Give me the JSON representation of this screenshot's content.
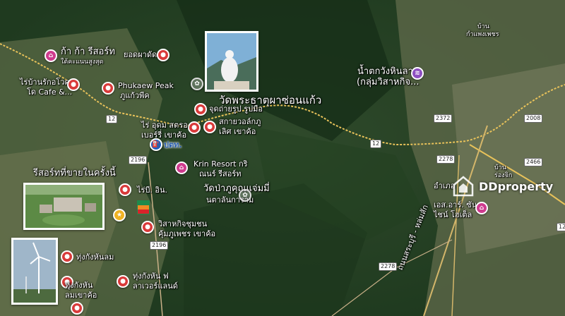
{
  "places": {
    "kakaresort": "ก้า ก้า รีสอร์ท",
    "kakaresort_sub": "ใต้คะแนนสูงสุด",
    "yodphadet": "ยอดผาดัด",
    "raibanrak_1": "ไร่บ้านรักอโวคา",
    "raibanrak_2": "โด Cafe &...",
    "phukaew_1": "Phukaew Peak",
    "phukaew_2": "ภูแก้วพีค",
    "wat_main": "วัดพระธาตุผาซ่อนแก้ว",
    "viewpoint": "จุดถ่ายรูป รูปมือ",
    "sakaya_1": "สกายวอล์กภู",
    "sakaya_2": "เลิศ เขาค้อ",
    "raiudom_1": "ไร่ อุดม สตรอ",
    "raiudom_2": "เบอร์รี่ เขาค้อ",
    "ptt": "ปตท.",
    "krin_1": "Krin Resort กริ",
    "krin_2": "ณนร์ รีสอร์ท",
    "wat2_1": "วัดป่าภูคุณแจ่มมี่",
    "wat2_2": "นตาลันการาม",
    "rai_in": "ไร่บี. อิน.",
    "resort_sale": "รีสอร์ทที่ขายในครั้งนี้",
    "witsahakit_1": "วิสาหกิจชุมชน",
    "witsahakit_2": "คุ้มภูเพชร เขาค้อ",
    "tungkanglom": "ทุ่งกังหันลม",
    "tungkanglom_fl_1": "ทุ่งกังหัน ฟ",
    "tungkanglom_fl_2": "ลาเวอร์แลนด์",
    "tungkanglom2_1": "ทุ่งกังหัน",
    "tungkanglom2_2": "ลมเขาค้อ",
    "namtok_1": "น้ำตกวังหินลาด",
    "namtok_2": "(กลุ่มวิสาหกิจ...",
    "sr_1": "เอส.อาร์. ซัน",
    "sr_2": "ไชน์ โฮเต็ล",
    "ban_kamphet_1": "บ้าน",
    "ban_kamphet_2": "กำแพงเพชร",
    "amphoe": "อำเภอ",
    "ban_right_1": "บ้าน",
    "ban_right_2": "ร่องจิก",
    "road_bottom": "ถนนสระบุรี - หล่มสัก"
  },
  "roads": {
    "r12_a": "12",
    "r12_b": "12",
    "r2196_a": "2196",
    "r2196_b": "2196",
    "r2372": "2372",
    "r2008": "2008",
    "r2278_a": "2278",
    "r2278_b": "2278",
    "r2466": "2466",
    "r12_c": "12"
  },
  "brand": {
    "name": "DDproperty"
  },
  "colors": {
    "pin_red": "#d93a3a",
    "pin_pink": "#cf3b8e",
    "pin_purple": "#8e4fc1",
    "road_yellow": "#e8c25a"
  }
}
